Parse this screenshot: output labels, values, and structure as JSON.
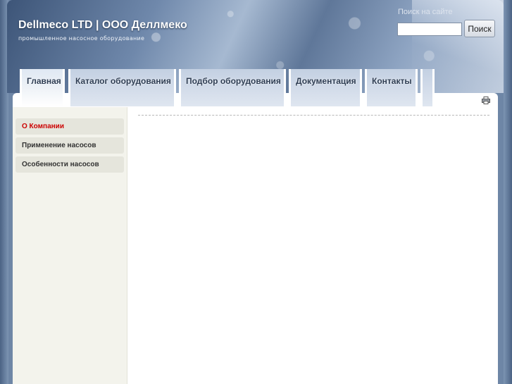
{
  "header": {
    "title": "Dellmeco LTD | ООО Деллмеко",
    "tagline": "промышленное насосное оборудование"
  },
  "search": {
    "label": "Поиск на сайте",
    "placeholder": "",
    "value": "",
    "button_label": "Поиск"
  },
  "nav": {
    "tabs": [
      {
        "label": "Главная",
        "active": true
      },
      {
        "label": "Каталог оборудования"
      },
      {
        "label": "Подбор оборудования"
      },
      {
        "label": "Документация"
      },
      {
        "label": "Контакты"
      },
      {
        "label": ""
      }
    ]
  },
  "sidebar": {
    "items": [
      {
        "label": "О Компании",
        "active": true
      },
      {
        "label": "Применение насосов"
      },
      {
        "label": "Особенности насосов"
      }
    ]
  },
  "icons": {
    "print": "print-icon"
  },
  "colors": {
    "active_menu_text": "#cc0000",
    "header_blue": "#6f88ab",
    "sidebar_bg": "#f3f3ec"
  }
}
